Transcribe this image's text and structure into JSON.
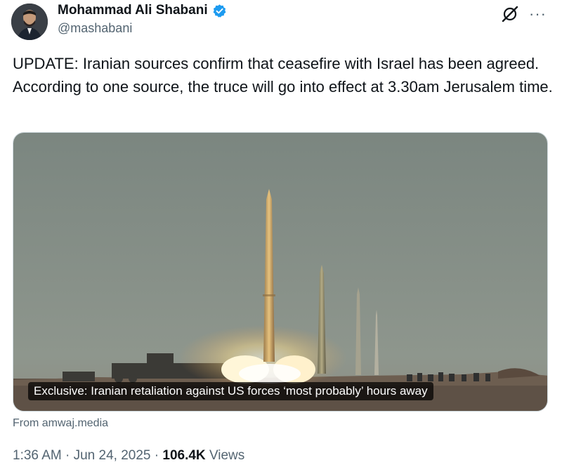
{
  "author": {
    "name": "Mohammad Ali Shabani",
    "handle": "@mashabani",
    "verified_color": "#1d9bf0"
  },
  "tweet": {
    "text": "UPDATE: Iranian sources confirm that ceasefire with Israel has been agreed. According to one source, the truce will go into effect at 3.30am Jerusalem time."
  },
  "media": {
    "caption": "Exclusive: Iranian retaliation against US forces ‘most probably’ hours away",
    "source": "From amwaj.media"
  },
  "meta": {
    "time": "1:36 AM",
    "separator": "·",
    "date": "Jun 24, 2025",
    "views_count": "106.4K",
    "views_label": "Views"
  },
  "icons": {
    "verified": "verified-badge-icon",
    "grok": "grok-icon",
    "more": "more-icon"
  }
}
